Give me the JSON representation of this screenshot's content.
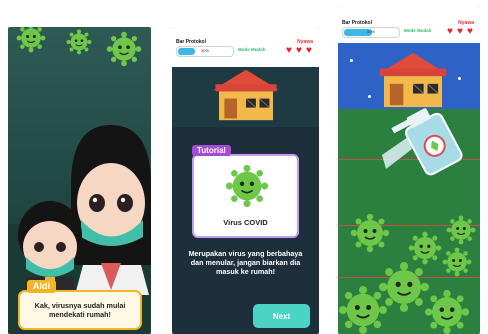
{
  "panel1": {
    "speaker": "Aldi",
    "dialog": "Kak, virusnya sudah mulai mendekati rumah!",
    "virus_icon": "virus-icon"
  },
  "panel2": {
    "hud": {
      "protocol_label": "Bar Protokol",
      "bar_value_text": "30%",
      "bar_fill_percent": 30,
      "mode_label": "Mode Mudah",
      "lives_label": "Nyawa",
      "lives": 3
    },
    "tutorial_tag": "Tutorial",
    "card_title": "Virus COVID",
    "description": "Merupakan virus yang berbahaya dan menular, jangan biarkan dia masuk ke rumah!",
    "next_label": "Next"
  },
  "panel3": {
    "hud": {
      "protocol_label": "Bar Protokol",
      "bar_value_text": "50%",
      "bar_fill_percent": 50,
      "mode_label": "Mode Mudah",
      "lives_label": "Nyawa",
      "lives": 3
    },
    "spray_icon": "spray-bottle-icon"
  },
  "colors": {
    "virus": "#6fc74a",
    "accent_gold": "#f3b428",
    "tutorial_purple": "#a64bd6",
    "next_teal": "#4bd3c3",
    "heart_red": "#e3262d"
  }
}
